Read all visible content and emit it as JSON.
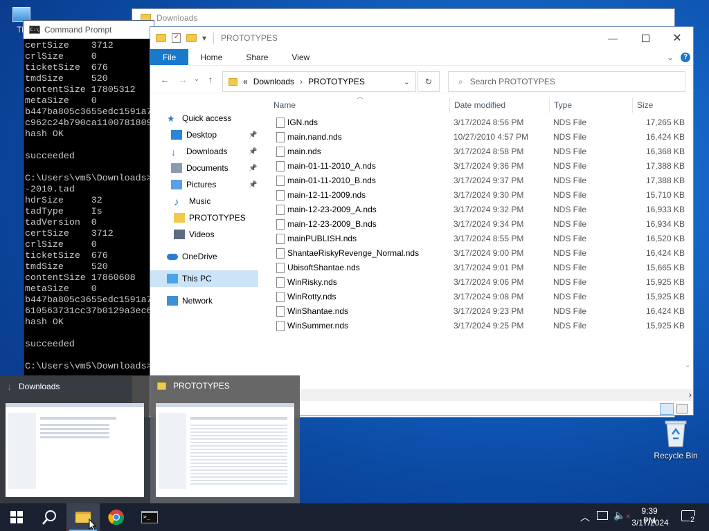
{
  "desktop": {
    "this_pc_label": "Th",
    "recycle_bin_label": "Recycle Bin"
  },
  "back_window": {
    "title": "Downloads"
  },
  "cmd": {
    "title": "Command Prompt",
    "lines": [
      "certSize    3712",
      "crlSize     0",
      "ticketSize  676",
      "tmdSize     520",
      "contentSize 17805312",
      "metaSize    0",
      "b447ba805c3655edc1591a7",
      "c962c24b790ca1100781809",
      "hash OK",
      "",
      "succeeded",
      "",
      "C:\\Users\\vm5\\Downloads>",
      "-2010.tad",
      "hdrSize     32",
      "tadType     Is",
      "tadVersion  0",
      "certSize    3712",
      "crlSize     0",
      "ticketSize  676",
      "tmdSize     520",
      "contentSize 17860608",
      "metaSize    0",
      "b447ba805c3655edc1591a7",
      "610563731cc37b0129a3ec6",
      "hash OK",
      "",
      "succeeded",
      "",
      "C:\\Users\\vm5\\Downloads>"
    ]
  },
  "explorer": {
    "title": "PROTOTYPES",
    "ribbon_tabs": [
      "File",
      "Home",
      "Share",
      "View"
    ],
    "address": {
      "prefix": "«",
      "crumbs": [
        "Downloads",
        "PROTOTYPES"
      ]
    },
    "search_placeholder": "Search PROTOTYPES",
    "nav": [
      {
        "label": "Quick access",
        "icon": "star-icon"
      },
      {
        "label": "Desktop",
        "icon": "desktop-icon",
        "pinned": true
      },
      {
        "label": "Downloads",
        "icon": "download-icon",
        "pinned": true
      },
      {
        "label": "Documents",
        "icon": "documents-icon",
        "pinned": true
      },
      {
        "label": "Pictures",
        "icon": "pictures-icon",
        "pinned": true
      },
      {
        "label": "Music",
        "icon": "music-icon"
      },
      {
        "label": "PROTOTYPES",
        "icon": "folder-icon"
      },
      {
        "label": "Videos",
        "icon": "videos-icon"
      },
      {
        "label": "OneDrive",
        "icon": "cloud-icon"
      },
      {
        "label": "This PC",
        "icon": "computer-icon",
        "selected": true
      },
      {
        "label": "Network",
        "icon": "network-icon"
      }
    ],
    "columns": [
      "Name",
      "Date modified",
      "Type",
      "Size"
    ],
    "files": [
      {
        "name": "IGN.nds",
        "date": "3/17/2024 8:56 PM",
        "type": "NDS File",
        "size": "17,265 KB"
      },
      {
        "name": "main.nand.nds",
        "date": "10/27/2010 4:57 PM",
        "type": "NDS File",
        "size": "16,424 KB"
      },
      {
        "name": "main.nds",
        "date": "3/17/2024 8:58 PM",
        "type": "NDS File",
        "size": "16,368 KB"
      },
      {
        "name": "main-01-11-2010_A.nds",
        "date": "3/17/2024 9:36 PM",
        "type": "NDS File",
        "size": "17,388 KB"
      },
      {
        "name": "main-01-11-2010_B.nds",
        "date": "3/17/2024 9:37 PM",
        "type": "NDS File",
        "size": "17,388 KB"
      },
      {
        "name": "main-12-11-2009.nds",
        "date": "3/17/2024 9:30 PM",
        "type": "NDS File",
        "size": "15,710 KB"
      },
      {
        "name": "main-12-23-2009_A.nds",
        "date": "3/17/2024 9:32 PM",
        "type": "NDS File",
        "size": "16,933 KB"
      },
      {
        "name": "main-12-23-2009_B.nds",
        "date": "3/17/2024 9:34 PM",
        "type": "NDS File",
        "size": "16,934 KB"
      },
      {
        "name": "mainPUBLISH.nds",
        "date": "3/17/2024 8:55 PM",
        "type": "NDS File",
        "size": "16,520 KB"
      },
      {
        "name": "ShantaeRiskyRevenge_Normal.nds",
        "date": "3/17/2024 9:00 PM",
        "type": "NDS File",
        "size": "16,424 KB"
      },
      {
        "name": "UbisoftShantae.nds",
        "date": "3/17/2024 9:01 PM",
        "type": "NDS File",
        "size": "15,665 KB"
      },
      {
        "name": "WinRisky.nds",
        "date": "3/17/2024 9:06 PM",
        "type": "NDS File",
        "size": "15,925 KB"
      },
      {
        "name": "WinRotty.nds",
        "date": "3/17/2024 9:08 PM",
        "type": "NDS File",
        "size": "15,925 KB"
      },
      {
        "name": "WinShantae.nds",
        "date": "3/17/2024 9:23 PM",
        "type": "NDS File",
        "size": "16,424 KB"
      },
      {
        "name": "WinSummer.nds",
        "date": "3/17/2024 9:25 PM",
        "type": "NDS File",
        "size": "15,925 KB"
      }
    ]
  },
  "thumbnails": [
    {
      "title": "Downloads",
      "icon": "download-icon"
    },
    {
      "title": "PROTOTYPES",
      "icon": "folder-icon"
    }
  ],
  "taskbar": {
    "apps": [
      "start-icon",
      "search-icon",
      "file-explorer-icon",
      "chrome-icon",
      "terminal-icon"
    ],
    "time": "9:39 PM",
    "date": "3/17/2024",
    "notification_count": "2"
  },
  "colors": {
    "file_tab": "#1979ca",
    "taskbar": "#1a2130",
    "folder": "#f2c94c"
  }
}
